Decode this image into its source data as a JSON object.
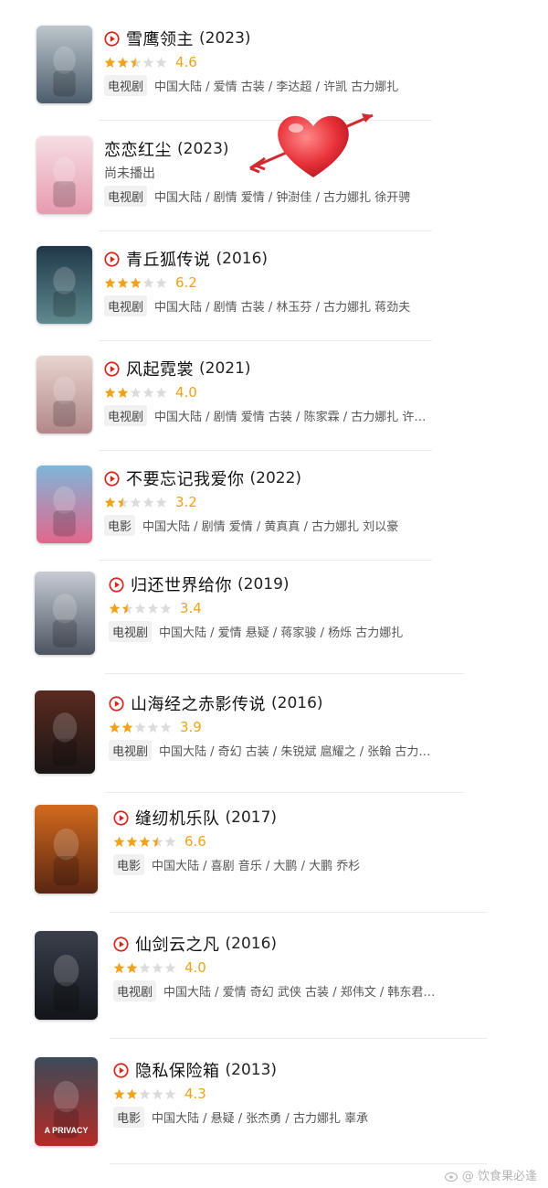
{
  "colors": {
    "accent_red": "#d9241c",
    "star_gold": "#f0a21a",
    "star_gray": "#dcdcdc"
  },
  "items": [
    {
      "title": "雪鹰领主",
      "year": "(2023)",
      "rating": 2.5,
      "score": "4.6",
      "has_play": true,
      "status": "",
      "type": "电视剧",
      "meta": "中国大陆 / 爱情 古装 / 李达超 / 许凯 古力娜扎",
      "poster_colors": [
        "#bdc6cc",
        "#4d5d6c"
      ]
    },
    {
      "title": "恋恋红尘",
      "year": "(2023)",
      "rating": null,
      "score": "",
      "has_play": false,
      "status": "尚未播出",
      "type": "电视剧",
      "meta": "中国大陆 / 剧情 爱情 / 钟澍佳 / 古力娜扎 徐开骋",
      "poster_colors": [
        "#f6dde4",
        "#e79bb0"
      ]
    },
    {
      "title": "青丘狐传说",
      "year": "(2016)",
      "rating": 3,
      "score": "6.2",
      "has_play": true,
      "status": "",
      "type": "电视剧",
      "meta": "中国大陆 / 剧情 古装 / 林玉芬 / 古力娜扎 蒋劲夫",
      "poster_colors": [
        "#20384a",
        "#5f8a8e"
      ]
    },
    {
      "title": "风起霓裳",
      "year": "(2021)",
      "rating": 2,
      "score": "4.0",
      "has_play": true,
      "status": "",
      "type": "电视剧",
      "meta": "中国大陆 / 剧情 爱情 古装 / 陈家霖 / 古力娜扎 许…",
      "poster_colors": [
        "#e8d4d0",
        "#b2888a"
      ]
    },
    {
      "title": "不要忘记我爱你",
      "year": "(2022)",
      "rating": 1.5,
      "score": "3.2",
      "has_play": true,
      "status": "",
      "type": "电影",
      "meta": "中国大陆 / 剧情 爱情 / 黄真真 / 古力娜扎 刘以豪",
      "poster_colors": [
        "#7fb6d8",
        "#e2678c"
      ]
    },
    {
      "title": "归还世界给你",
      "year": "(2019)",
      "rating": 1.5,
      "score": "3.4",
      "has_play": true,
      "status": "",
      "type": "电视剧",
      "meta": "中国大陆 / 爱情 悬疑 / 蒋家骏 / 杨烁 古力娜扎",
      "poster_colors": [
        "#c7ccd4",
        "#4c5460"
      ]
    },
    {
      "title": "山海经之赤影传说",
      "year": "(2016)",
      "rating": 2,
      "score": "3.9",
      "has_play": true,
      "status": "",
      "type": "电视剧",
      "meta": "中国大陆 / 奇幻 古装 / 朱锐斌 扈耀之 / 张翰 古力…",
      "poster_colors": [
        "#5a2a20",
        "#1a1616"
      ]
    },
    {
      "title": "缝纫机乐队",
      "year": "(2017)",
      "rating": 3.5,
      "score": "6.6",
      "has_play": true,
      "status": "",
      "type": "电影",
      "meta": "中国大陆 / 喜剧 音乐 / 大鹏 / 大鹏 乔杉",
      "poster_colors": [
        "#d26a1e",
        "#5a2612"
      ]
    },
    {
      "title": "仙剑云之凡",
      "year": "(2016)",
      "rating": 2,
      "score": "4.0",
      "has_play": true,
      "status": "",
      "type": "电视剧",
      "meta": "中国大陆 / 爱情 奇幻 武侠 古装 / 郑伟文 / 韩东君…",
      "poster_colors": [
        "#3a3f4a",
        "#12141a"
      ]
    },
    {
      "title": "隐私保险箱",
      "year": "(2013)",
      "rating": 2,
      "score": "4.3",
      "has_play": true,
      "status": "",
      "type": "电影",
      "meta": "中国大陆 / 悬疑 / 张杰勇 / 古力娜扎 辜承",
      "poster_colors": [
        "#3b4b58",
        "#b52a26"
      ]
    }
  ],
  "poster_texts": {
    "p5": "A PRIVACY"
  },
  "watermark": "@ 饮食果必逢"
}
